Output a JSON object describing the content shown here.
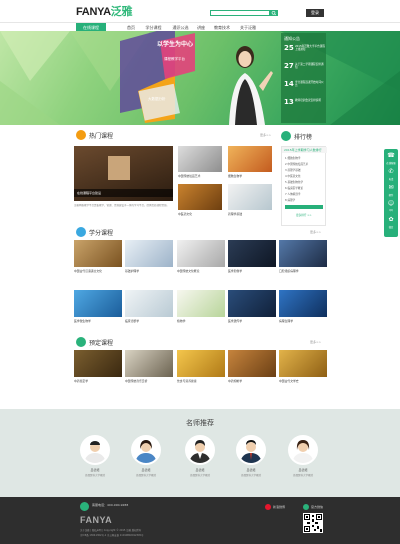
{
  "header": {
    "logo_en": "FANYA",
    "logo_cn": "泛雅",
    "search_placeholder": "",
    "login_label": "登录"
  },
  "nav": {
    "items": [
      {
        "label": "在线课程",
        "active": true
      },
      {
        "label": "首页"
      },
      {
        "label": "学分课程"
      },
      {
        "label": "通识公选"
      },
      {
        "label": "讲座"
      },
      {
        "label": "教育技术"
      },
      {
        "label": "关于泛雅"
      }
    ]
  },
  "banner": {
    "headline": "以学生为中心",
    "sub1": "课程教学平台",
    "sub2": "大数据分析",
    "notice": {
      "title": "通知公告",
      "items": [
        {
          "day": "25",
          "text": "2015年泛雅大学平台课程上线通知"
        },
        {
          "day": "27",
          "text": "关于第二学期课程安排通知"
        },
        {
          "day": "14",
          "text": "学分课程选课开始时间公告"
        },
        {
          "day": "13",
          "text": "教师培训会议安排说明"
        }
      ]
    }
  },
  "hot": {
    "title": "热门课程",
    "more": "更多>>",
    "feature_caption": "在线课程平台建设",
    "feature_desc": "泛雅网络教学平台是集教学、管理、资源建设于一体的学习平台，提供优质课程资源。",
    "items": [
      {
        "caption": "中国传统绘画艺术",
        "sub": "主讲教师：王老师"
      },
      {
        "caption": "细胞生物学",
        "sub": "主讲教师：李老师"
      },
      {
        "caption": "中医药文化",
        "sub": "主讲教师：张老师"
      },
      {
        "caption": "药理学基础",
        "sub": "主讲教师：陈老师"
      }
    ]
  },
  "rank": {
    "title": "排行榜",
    "header": "2015年上学期学习人数排行",
    "items": [
      "1 细胞生物学",
      "2 中国传统绘画艺术",
      "3 药理学基础",
      "4 中医药文化",
      "5 基础生物化学",
      "6 临床医学概论",
      "7 人体解剖学",
      "8 病理学"
    ],
    "more": "更多排行 >>"
  },
  "credit": {
    "title": "学分课程",
    "more": "更多>>",
    "items": [
      {
        "caption": "中国古代汉语语言文化",
        "sub": "主讲教师"
      },
      {
        "caption": "基础护理学",
        "sub": "主讲教师"
      },
      {
        "caption": "中国传统文化概论",
        "sub": "主讲教师"
      },
      {
        "caption": "医学影像学",
        "sub": "主讲教师"
      },
      {
        "caption": "口腔组织病理学",
        "sub": "主讲教师"
      },
      {
        "caption": "医学微生物学",
        "sub": "主讲教师"
      },
      {
        "caption": "临床诊断学",
        "sub": "主讲教师"
      },
      {
        "caption": "植物学",
        "sub": "主讲教师"
      },
      {
        "caption": "医学遗传学",
        "sub": "主讲教师"
      },
      {
        "caption": "病理生理学",
        "sub": "主讲教师"
      }
    ]
  },
  "preview": {
    "title": "预定课程",
    "more": "更多>>",
    "items": [
      {
        "caption": "中药鉴定学",
        "sub": "主讲教师"
      },
      {
        "caption": "中国传统音乐赏析",
        "sub": "主讲教师"
      },
      {
        "caption": "饮食与营养健康",
        "sub": "主讲教师"
      },
      {
        "caption": "中药炮制学",
        "sub": "主讲教师"
      },
      {
        "caption": "中国古代文学史",
        "sub": "主讲教师"
      }
    ]
  },
  "teachers": {
    "title": "名师推荐",
    "list": [
      {
        "name": "吕德培",
        "desc": "首都医科大学教授"
      },
      {
        "name": "吕德培",
        "desc": "首都医科大学教授"
      },
      {
        "name": "吕德培",
        "desc": "首都医科大学教授"
      },
      {
        "name": "吕德培",
        "desc": "首都医科大学教授"
      },
      {
        "name": "吕德培",
        "desc": "首都医科大学教授"
      }
    ]
  },
  "footer": {
    "phone": "客服电话：400-990-9288",
    "logo": "FANYA",
    "line1": "关于泛雅 | 隐私声明 | Copyright © 2015 泛雅 版权所有",
    "line2": "京ICP备 13041302号-1 京公网安备 11010802012345号",
    "weibo": "新浪微博",
    "wechat": "官方微信"
  },
  "sidebar_float": {
    "items": [
      "在线客服",
      "电话",
      "邮件",
      "QQ",
      "微信"
    ]
  },
  "colors": {
    "accent": "#27b07a",
    "footer_bg": "#2e2e2e",
    "teachers_bg": "#dfe7e4"
  }
}
